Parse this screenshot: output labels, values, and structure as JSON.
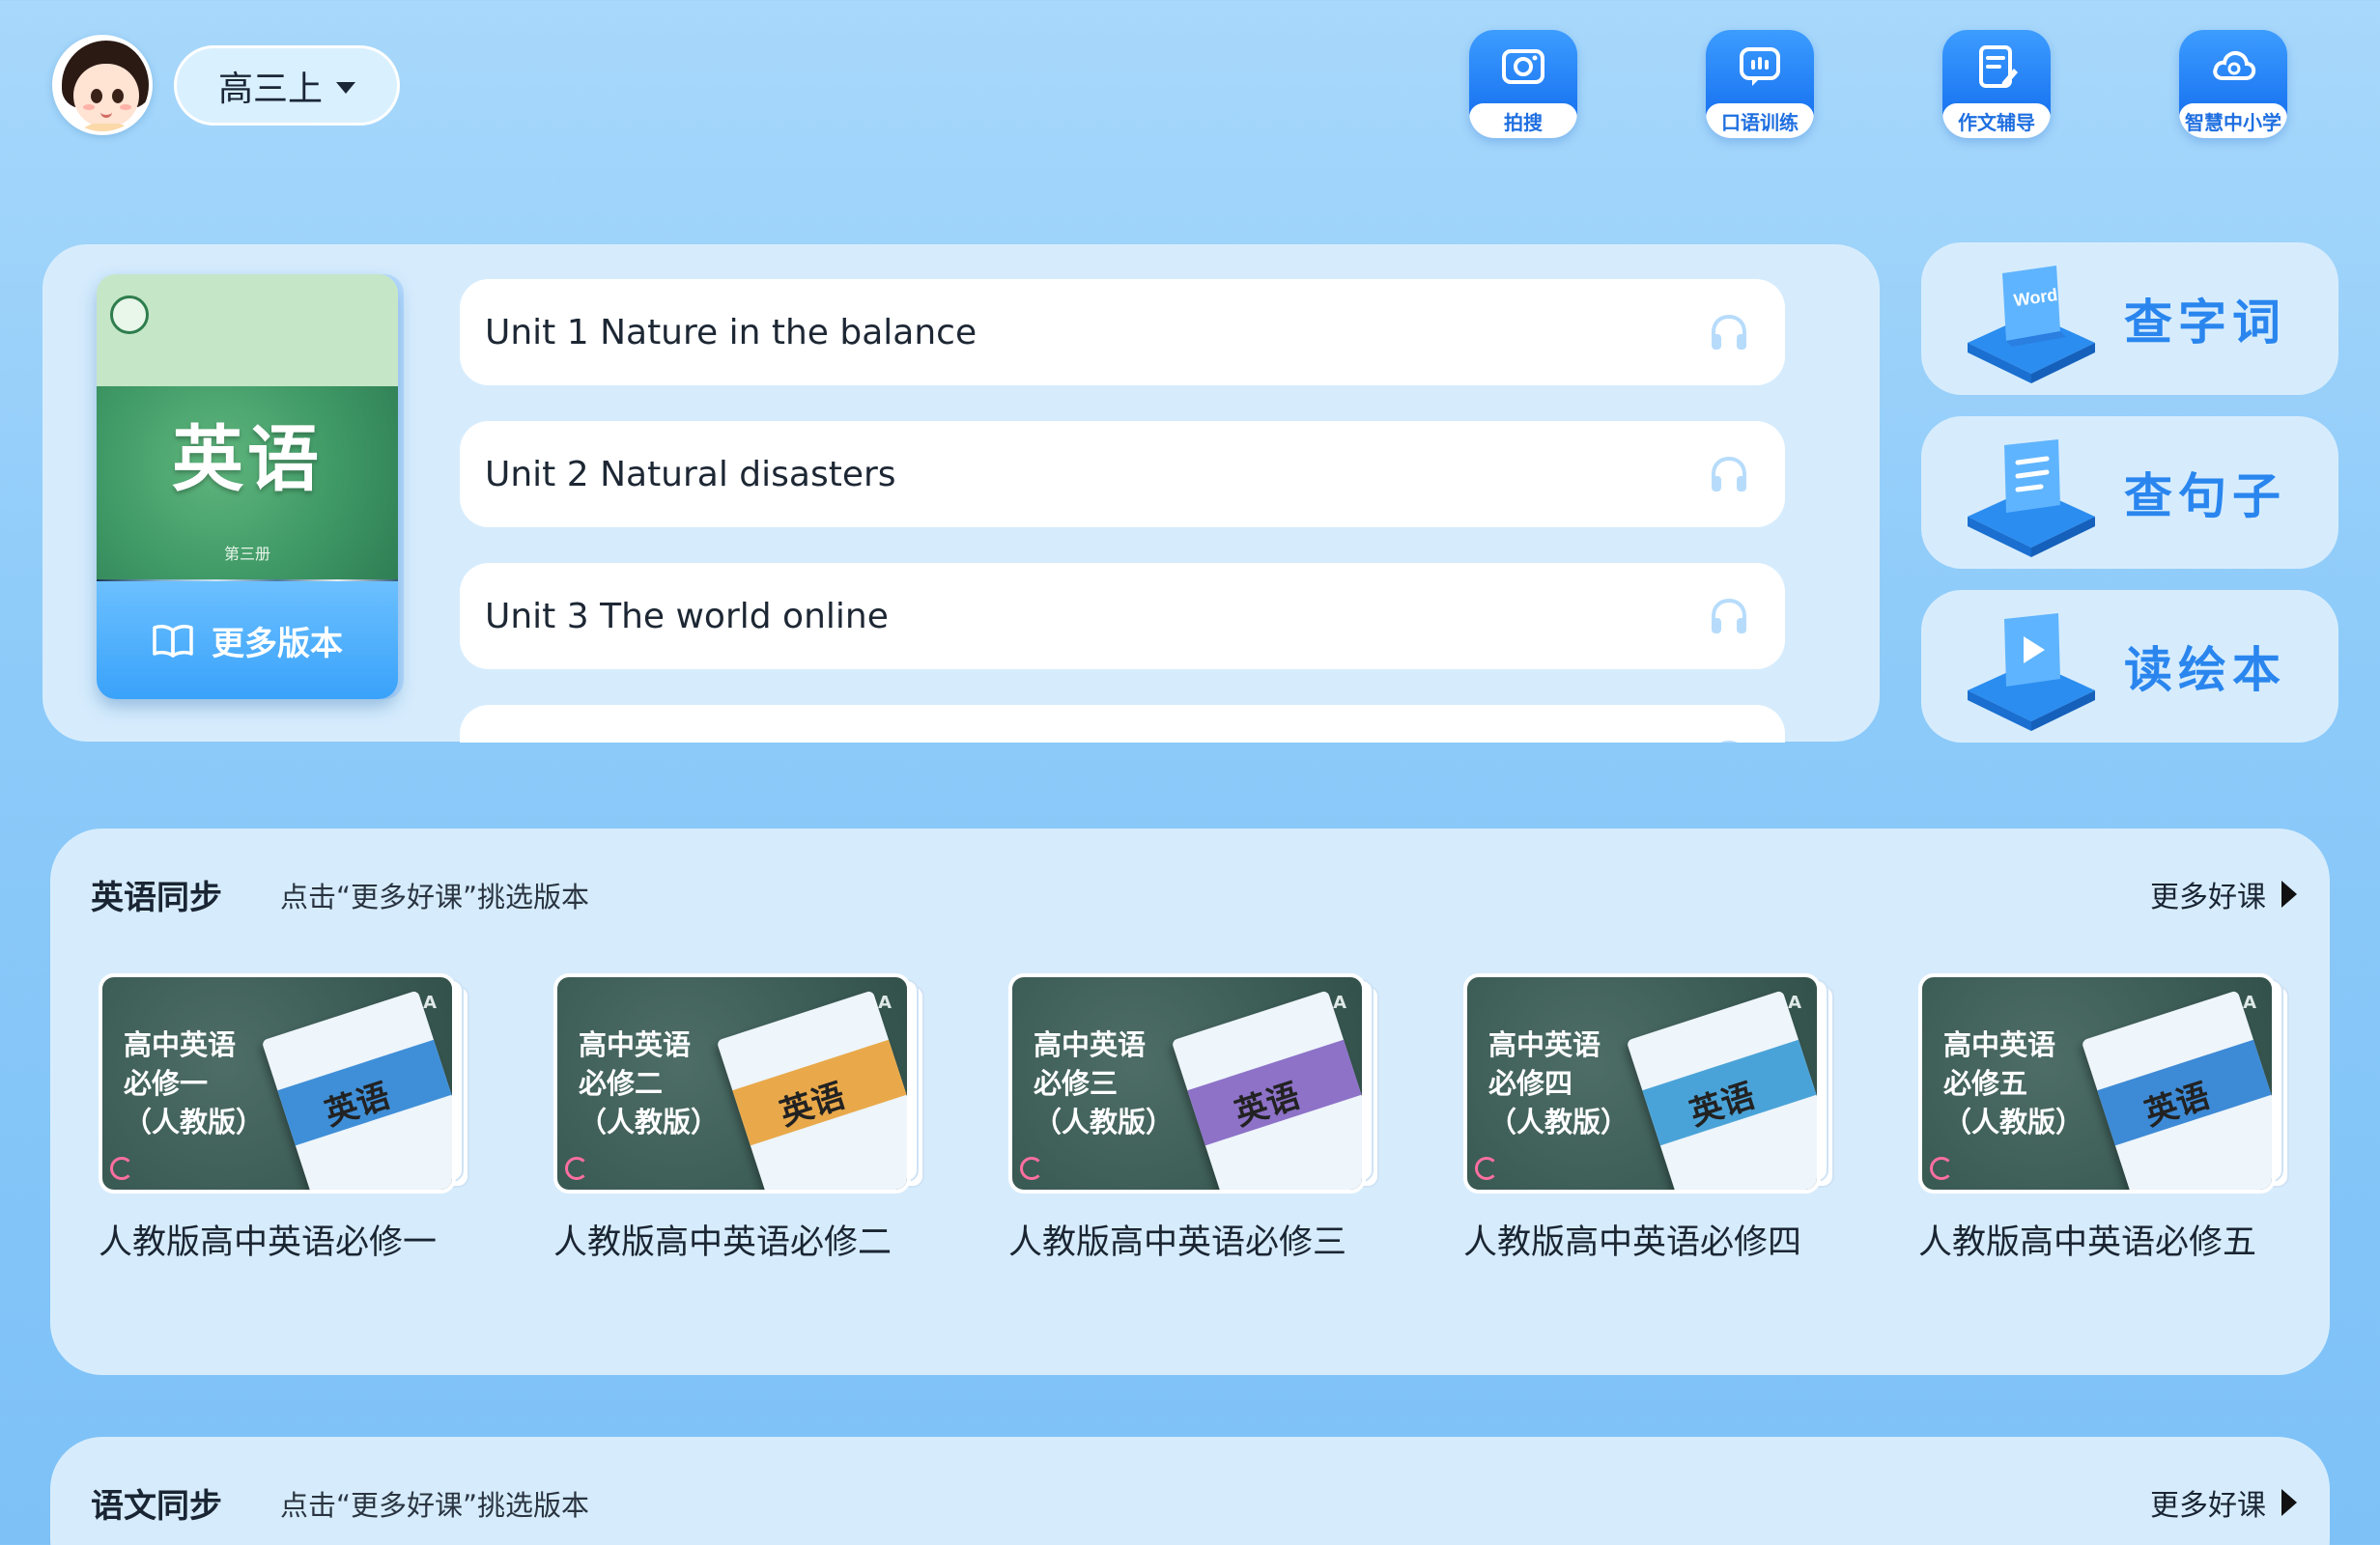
{
  "header": {
    "grade": "高三上",
    "tools": [
      {
        "label": "拍搜",
        "icon": "camera-icon"
      },
      {
        "label": "口语训练",
        "icon": "speech-bubble-icon"
      },
      {
        "label": "作文辅导",
        "icon": "document-edit-icon"
      },
      {
        "label": "智慧中小学",
        "icon": "cloud-icon"
      }
    ]
  },
  "textbook": {
    "title": "英语",
    "volume": "第三册",
    "more_versions": "更多版本",
    "units": [
      {
        "label": "Unit 1  Nature in the balance"
      },
      {
        "label": "Unit 2  Natural disasters"
      },
      {
        "label": "Unit 3  The world online"
      },
      {
        "label": ""
      }
    ]
  },
  "side_tools": [
    {
      "label": "查字词",
      "icon": "word-book-icon",
      "badge": "Word"
    },
    {
      "label": "查句子",
      "icon": "sentence-book-icon"
    },
    {
      "label": "读绘本",
      "icon": "play-book-icon"
    }
  ],
  "english_section": {
    "title": "英语同步",
    "hint": "点击“更多好课”挑选版本",
    "more": "更多好课",
    "courses": [
      {
        "board_line1": "高中英语",
        "board_line2": "必修一",
        "board_line3": "（人教版）",
        "book_title": "英语",
        "band_color": "#3f8fd8",
        "name": "人教版高中英语必修一"
      },
      {
        "board_line1": "高中英语",
        "board_line2": "必修二",
        "board_line3": "（人教版）",
        "book_title": "英语",
        "band_color": "#e9a94a",
        "name": "人教版高中英语必修二"
      },
      {
        "board_line1": "高中英语",
        "board_line2": "必修三",
        "board_line3": "（人教版）",
        "book_title": "英语",
        "band_color": "#8d72c8",
        "name": "人教版高中英语必修三"
      },
      {
        "board_line1": "高中英语",
        "board_line2": "必修四",
        "board_line3": "（人教版）",
        "book_title": "英语",
        "band_color": "#4aa3d8",
        "name": "人教版高中英语必修四"
      },
      {
        "board_line1": "高中英语",
        "board_line2": "必修五",
        "board_line3": "（人教版）",
        "book_title": "英语",
        "band_color": "#3d8ad6",
        "name": "人教版高中英语必修五"
      }
    ]
  },
  "chinese_section": {
    "title": "语文同步",
    "hint": "点击“更多好课”挑选版本",
    "more": "更多好课"
  },
  "colors": {
    "accent": "#1d78f2",
    "side_label": "#2a86ee",
    "panel": "#d6ecfd"
  }
}
